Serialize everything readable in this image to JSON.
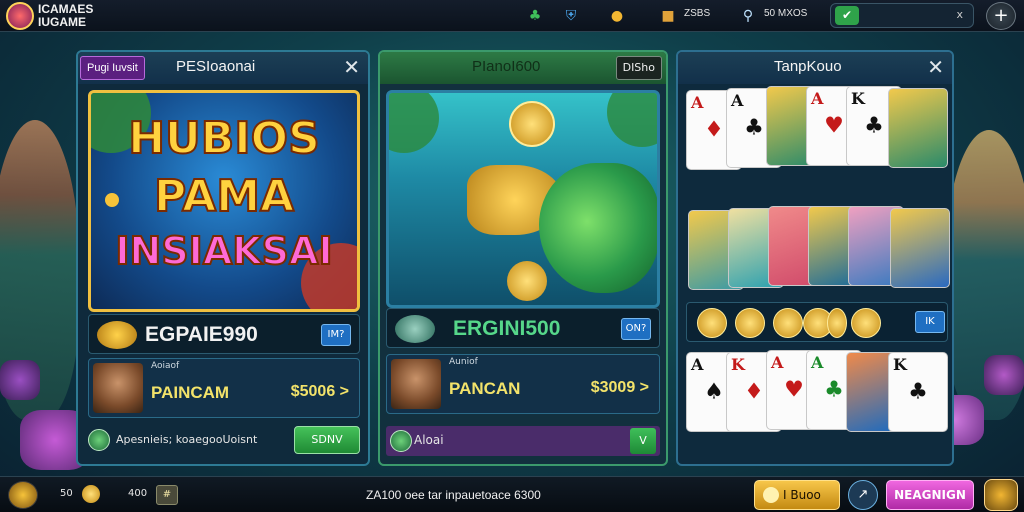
{
  "header": {
    "brand_line1": "ICAMAES",
    "brand_line2": "IUGAME",
    "stat1": "ZSBS",
    "stat2": "50 MXOS",
    "toggle_close": "x",
    "plus": "+"
  },
  "panel1": {
    "tag": "Pugi Iuvsit",
    "title": "PESIoaonai",
    "close": "✕",
    "art_line1": "HUBIOS",
    "art_line2": "PAMA",
    "art_line3": "INSIAKSAI",
    "jackpot": "EGPAIE990",
    "jackpot_btn": "IM?",
    "player_label": "Aoiaof",
    "player_name": "PAINCAM",
    "player_price": "$5006 >",
    "footer_text": "Apesnieis; koaegooUoisnt",
    "footer_btn": "SDNV"
  },
  "panel2": {
    "title": "PIanoI600",
    "badge": "DISho",
    "jackpot": "ERGINI500",
    "jackpot_btn": "ON?",
    "player_label": "Auniof",
    "player_name": "PANCAN",
    "player_price": "$3009 >",
    "footer_text": "Aloai",
    "footer_btn": "V"
  },
  "panel3": {
    "title": "TanpKouo",
    "close": "✕",
    "coins_btn": "IK"
  },
  "bottom": {
    "val1": "50",
    "val2": "400",
    "sq": "#",
    "message": "ZA100 oee tar inpauetoace 6300",
    "gold_btn": "I Buoo",
    "round_btn": "↗",
    "pink_btn": "NEAGNIGN"
  }
}
